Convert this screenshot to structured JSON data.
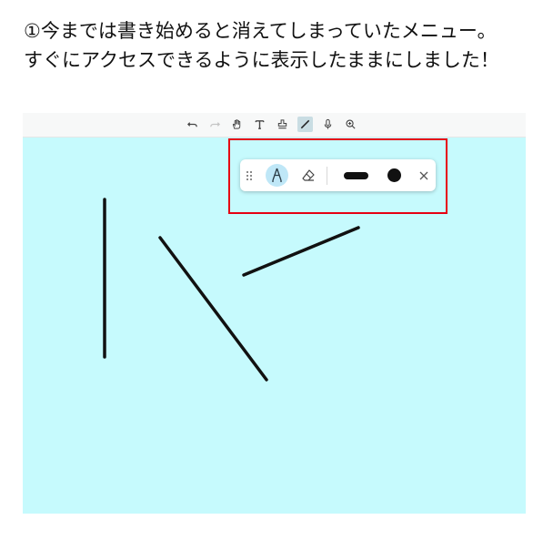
{
  "caption": {
    "line1": "①今までは書き始めると消えてしまっていたメニュー。",
    "line2": "すぐにアクセスできるように表示したままにしました！"
  },
  "toolbar": {
    "tools": [
      {
        "name": "undo",
        "icon": "undo-icon",
        "enabled": true
      },
      {
        "name": "redo",
        "icon": "redo-icon",
        "enabled": false
      },
      {
        "name": "pan",
        "icon": "hand-icon",
        "enabled": true
      },
      {
        "name": "text",
        "icon": "text-icon",
        "enabled": true
      },
      {
        "name": "stamp",
        "icon": "stamp-icon",
        "enabled": true
      },
      {
        "name": "pen",
        "icon": "pen-line-icon",
        "enabled": true,
        "active": true
      },
      {
        "name": "microphone",
        "icon": "microphone-icon",
        "enabled": true
      },
      {
        "name": "zoom",
        "icon": "zoom-icon",
        "enabled": true
      }
    ]
  },
  "pen_menu": {
    "items": [
      "drag-handle-icon",
      "pen-icon",
      "eraser-icon",
      "thickness-icon",
      "color-icon",
      "close-icon"
    ],
    "selected_tool": "pen",
    "pen_color": "#111111"
  },
  "colors": {
    "canvas_background": "#c6fafd",
    "highlight_border": "#e60012",
    "active_tool_background": "#bfe7f7",
    "stroke": "#111111"
  },
  "strokes_count": 3
}
